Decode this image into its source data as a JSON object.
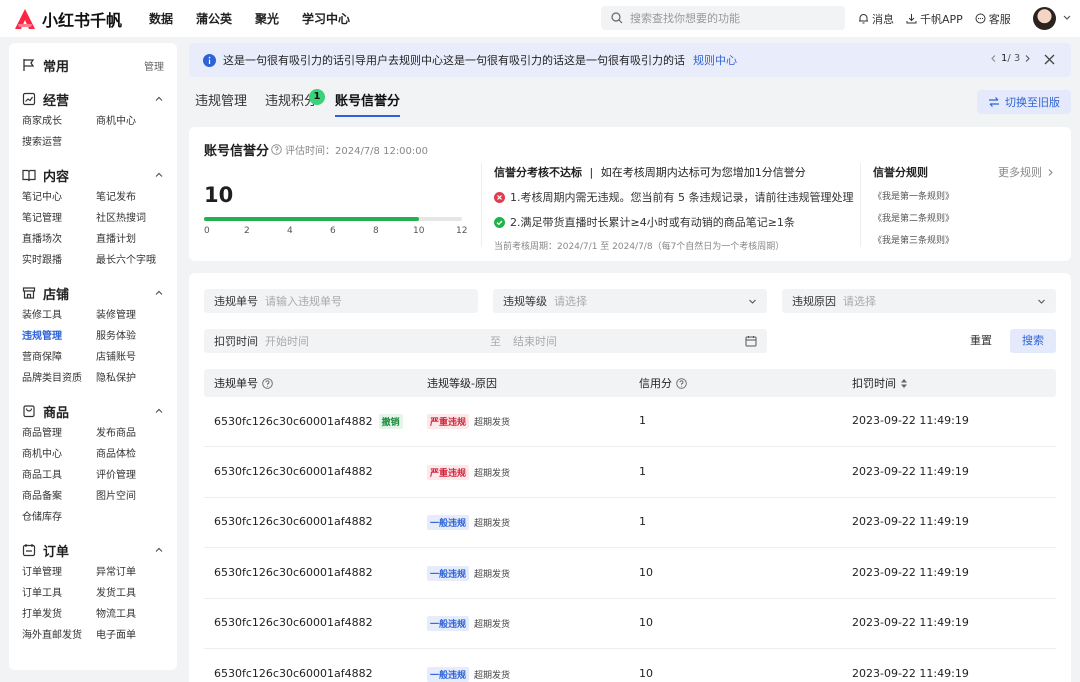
{
  "app": {
    "name": "小红书千帆"
  },
  "topnav": [
    "数据",
    "蒲公英",
    "聚光",
    "学习中心"
  ],
  "search": {
    "placeholder": "搜索查找你想要的功能"
  },
  "topright": {
    "messages": "消息",
    "app": "千帆APP",
    "service": "客服"
  },
  "sidebar": {
    "common": {
      "title": "常用",
      "manage": "管理"
    },
    "sections": [
      {
        "title": "经营",
        "items": [
          "商家成长",
          "商机中心",
          "搜索运营"
        ]
      },
      {
        "title": "内容",
        "items": [
          "笔记中心",
          "笔记发布",
          "笔记管理",
          "社区热搜词",
          "直播场次",
          "直播计划",
          "实时跟播",
          "最长六个字哦"
        ]
      },
      {
        "title": "店铺",
        "items": [
          "装修工具",
          "装修管理",
          "违规管理",
          "服务体验",
          "营商保障",
          "店铺账号",
          "品牌类目资质",
          "隐私保护"
        ]
      },
      {
        "title": "商品",
        "items": [
          "商品管理",
          "发布商品",
          "商机中心",
          "商品体检",
          "商品工具",
          "评价管理",
          "商品备案",
          "图片空间",
          "仓储库存"
        ]
      },
      {
        "title": "订单",
        "items": [
          "订单管理",
          "异常订单",
          "订单工具",
          "发货工具",
          "打单发货",
          "物流工具",
          "海外直邮发货",
          "电子面单"
        ]
      }
    ]
  },
  "notice": {
    "text": "这是一句很有吸引力的话引导用户去规则中心这是一句很有吸引力的话这是一句很有吸引力的话",
    "link": "规则中心",
    "current": "1",
    "total": "/ 3"
  },
  "tabs": [
    "违规管理",
    "违规积分",
    "账号信誉分"
  ],
  "tab_badge": "1",
  "switch_button": "切换至旧版",
  "credit": {
    "title": "账号信誉分",
    "eval_time": "评估时间：2024/7/8 12:00:00",
    "score": "10",
    "score_value": 10,
    "score_max": 12,
    "ticks": [
      "0",
      "2",
      "4",
      "6",
      "8",
      "10",
      "12"
    ],
    "assess_title": "信誉分考核不达标",
    "assess_desc": "如在考核周期内达标可为您增加1分信誉分",
    "item1": "1.考核周期内需无违规。您当前有 5 条违规记录，请前往违规管理处理",
    "item2": "2.满足带货直播时长累计≥4小时或有动销的商品笔记≥1条",
    "period": "当前考核周期：2024/7/1 至 2024/7/8（每7个自然日为一个考核周期）",
    "rules_title": "信誉分规则",
    "more_rules": "更多规则",
    "rules": [
      "《我是第一条规则》",
      "《我是第二条规则》",
      "《我是第三条规则》"
    ]
  },
  "filters": {
    "id_label": "违规单号",
    "id_placeholder": "请输入违规单号",
    "level_label": "违规等级",
    "level_placeholder": "请选择",
    "reason_label": "违规原因",
    "reason_placeholder": "请选择",
    "time_label": "扣罚时间",
    "start_placeholder": "开始时间",
    "to": "至",
    "end_placeholder": "结束时间",
    "reset": "重置",
    "search": "搜索"
  },
  "table": {
    "columns": [
      "违规单号",
      "违规等级-原因",
      "信用分",
      "扣罚时间"
    ],
    "rows": [
      {
        "id": "6530fc126c30c60001af4882",
        "status": "撤销",
        "level": "严重违规",
        "level_color": "red",
        "reason": "超期发货",
        "score": "1",
        "time": "2023-09-22 11:49:19"
      },
      {
        "id": "6530fc126c30c60001af4882",
        "status": "",
        "level": "严重违规",
        "level_color": "red",
        "reason": "超期发货",
        "score": "1",
        "time": "2023-09-22 11:49:19"
      },
      {
        "id": "6530fc126c30c60001af4882",
        "status": "",
        "level": "一般违规",
        "level_color": "blue",
        "reason": "超期发货",
        "score": "1",
        "time": "2023-09-22 11:49:19"
      },
      {
        "id": "6530fc126c30c60001af4882",
        "status": "",
        "level": "一般违规",
        "level_color": "blue",
        "reason": "超期发货",
        "score": "10",
        "time": "2023-09-22 11:49:19"
      },
      {
        "id": "6530fc126c30c60001af4882",
        "status": "",
        "level": "一般违规",
        "level_color": "blue",
        "reason": "超期发货",
        "score": "10",
        "time": "2023-09-22 11:49:19"
      },
      {
        "id": "6530fc126c30c60001af4882",
        "status": "",
        "level": "一般违规",
        "level_color": "blue",
        "reason": "超期发货",
        "score": "10",
        "time": "2023-09-22 11:49:19"
      }
    ]
  },
  "colors": {
    "accent": "#2e63d7",
    "brand": "#ff2442",
    "progress": "#23b14d",
    "badge": "#3ad37a"
  }
}
